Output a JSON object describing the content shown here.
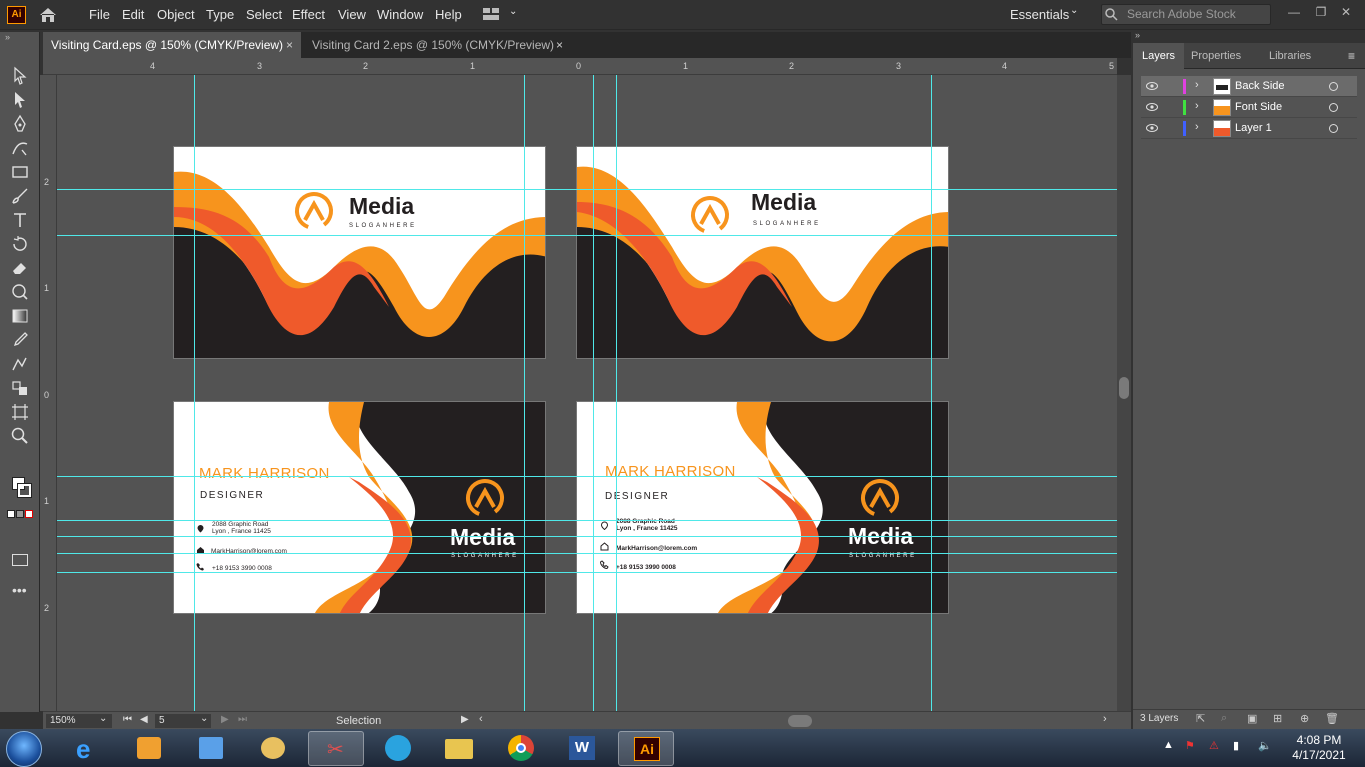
{
  "app": {
    "logo": "Ai",
    "menu": [
      "File",
      "Edit",
      "Object",
      "Type",
      "Select",
      "Effect",
      "View",
      "Window",
      "Help"
    ],
    "workspace": "Essentials",
    "search_placeholder": "Search Adobe Stock"
  },
  "tabs": [
    {
      "label": "Visiting Card.eps @ 150% (CMYK/Preview)",
      "close": "×"
    },
    {
      "label": "Visiting Card 2.eps @ 150% (CMYK/Preview)",
      "close": "×"
    }
  ],
  "rulers": {
    "horizontal": [
      "4",
      "3",
      "2",
      "1",
      "0",
      "1",
      "2",
      "3",
      "4",
      "5"
    ],
    "vertical": [
      "2",
      "1",
      "0",
      "1",
      "2"
    ]
  },
  "cards": {
    "brand": "Media",
    "slogan": "SLOGANHERE",
    "name": "MARK HARRISON",
    "role": "DESIGNER",
    "address_line1": "2088 Graphic Road",
    "address_line2": "Lyon , France 11425",
    "email": "MarkHarrison@lorem.com",
    "phone": "+18 9153 3990 0008"
  },
  "status": {
    "zoom": "150%",
    "artboard": "5",
    "tool": "Selection"
  },
  "layers_panel": {
    "tabs": [
      "Layers",
      "Properties",
      "Libraries"
    ],
    "layers": [
      {
        "name": "Back Side",
        "color": "#e040e0"
      },
      {
        "name": "Font Side",
        "color": "#40e040"
      },
      {
        "name": "Layer 1",
        "color": "#4060ff"
      }
    ],
    "count": "3 Layers"
  },
  "taskbar": {
    "time": "4:08 PM",
    "date": "4/17/2021"
  },
  "colors": {
    "orange": "#f7941d",
    "red_orange": "#ef5a2b",
    "dark": "#231f20",
    "guide": "#4fe8e8"
  }
}
